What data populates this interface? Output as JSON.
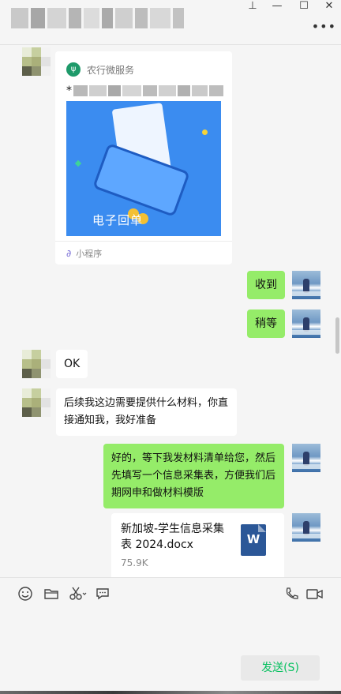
{
  "window": {
    "pin_icon": "pin-icon",
    "minimize_icon": "minimize-icon",
    "maximize_icon": "maximize-icon",
    "close_icon": "close-icon",
    "more_icon": "more-icon",
    "pin_glyph": "⊥",
    "minimize_glyph": "—",
    "maximize_glyph": "☐",
    "close_glyph": "✕",
    "more_glyph": "•••"
  },
  "messages": {
    "mini_program": {
      "app_name": "农行微服务",
      "desc_prefix": "*",
      "banner_text": "电子回单",
      "footer_label": "小程序"
    },
    "me_1": "收到",
    "me_2": "稍等",
    "them_1": "OK",
    "them_2": "后续我这边需要提供什么材料，你直接通知我，我好准备",
    "me_3": "好的，等下我发材料清单给您，然后先填写一个信息采集表，方便我们后期网申和做材料模版",
    "file": {
      "name": "新加坡-学生信息采集表 2024.docx",
      "size": "75.9K",
      "type_letter": "W"
    }
  },
  "toolbar": {
    "emoji_icon": "emoji-icon",
    "folder_icon": "folder-icon",
    "scissors_icon": "scissors-icon",
    "chat_bubble_icon": "chat-bubble-icon",
    "phone_icon": "phone-icon",
    "video_icon": "video-icon"
  },
  "send_label": "发送(S)",
  "colors": {
    "my_bubble": "#95ec69",
    "their_bubble": "#ffffff",
    "send_text": "#07c160",
    "background": "#f5f5f5"
  }
}
